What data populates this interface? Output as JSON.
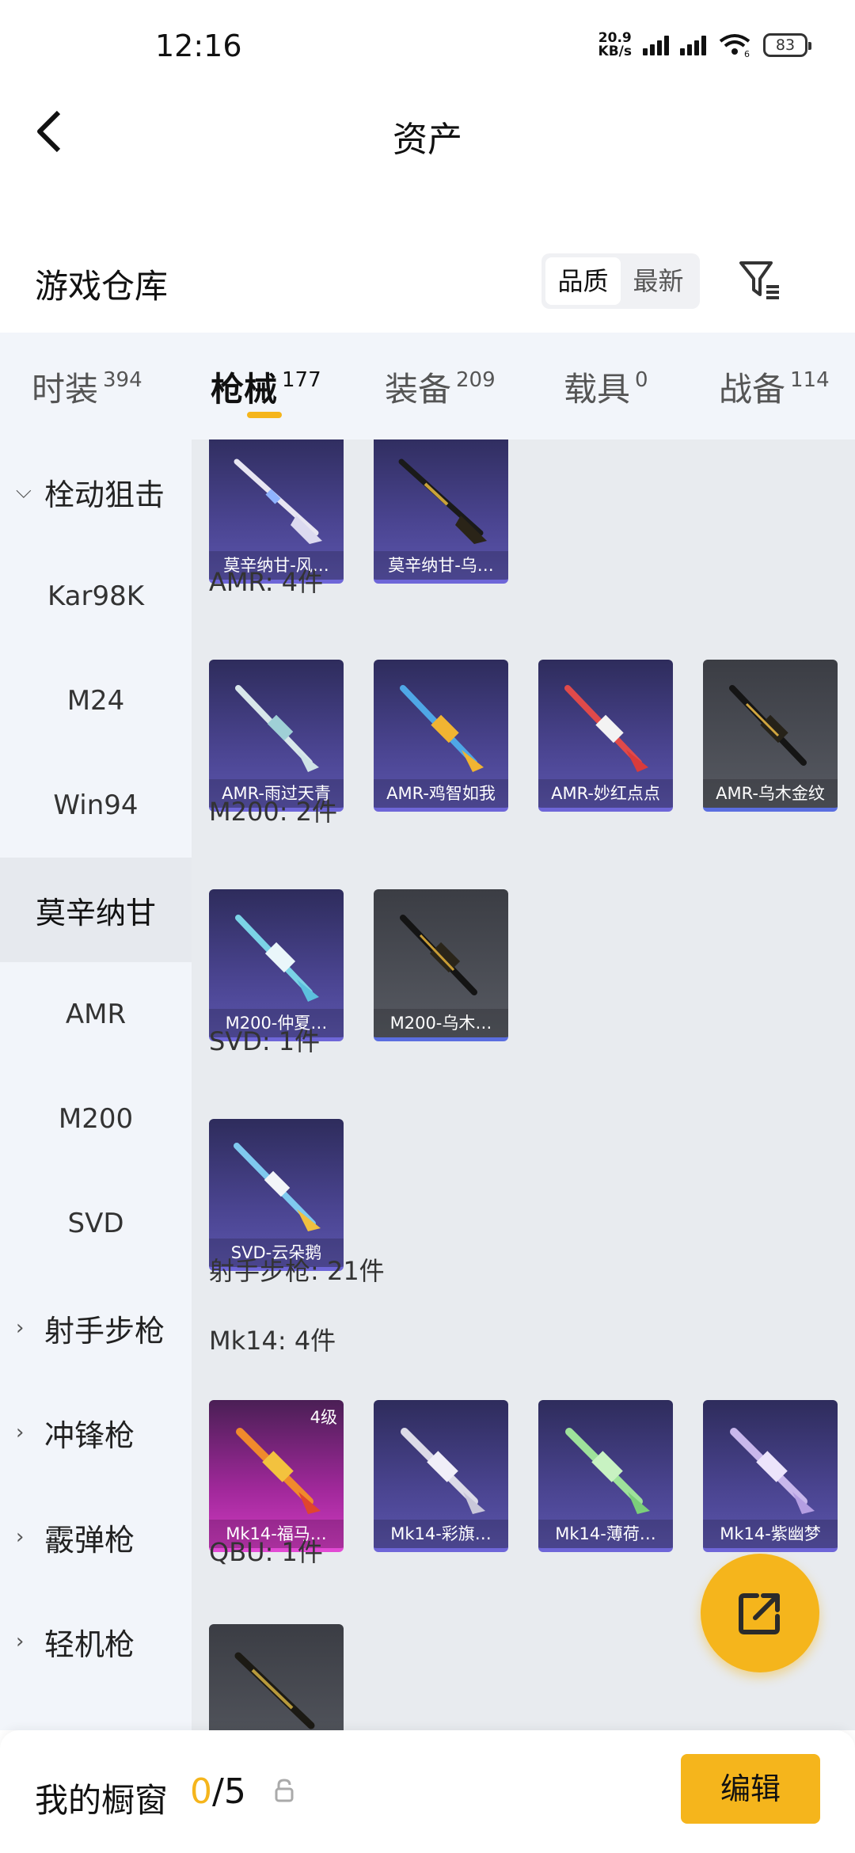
{
  "status_bar": {
    "time": "12:16",
    "net_speed_value": "20.9",
    "net_speed_unit": "KB/s",
    "wifi_badge": "6",
    "battery": "83"
  },
  "header": {
    "title": "资产"
  },
  "warehouse": {
    "title": "游戏仓库",
    "sort_options": [
      "品质",
      "最新"
    ],
    "active_sort": "品质"
  },
  "tabs": [
    {
      "label": "时装",
      "count": "394"
    },
    {
      "label": "枪械",
      "count": "177",
      "active": true
    },
    {
      "label": "装备",
      "count": "209"
    },
    {
      "label": "载具",
      "count": "0"
    },
    {
      "label": "战备",
      "count": "114"
    }
  ],
  "sidebar": [
    {
      "label": "栓动狙击",
      "type": "group",
      "expanded": true
    },
    {
      "label": "Kar98K",
      "type": "sub"
    },
    {
      "label": "M24",
      "type": "sub"
    },
    {
      "label": "Win94",
      "type": "sub"
    },
    {
      "label": "莫辛纳甘",
      "type": "sub",
      "selected": true
    },
    {
      "label": "AMR",
      "type": "sub"
    },
    {
      "label": "M200",
      "type": "sub"
    },
    {
      "label": "SVD",
      "type": "sub"
    },
    {
      "label": "射手步枪",
      "type": "group",
      "expanded": false
    },
    {
      "label": "冲锋枪",
      "type": "group",
      "expanded": false
    },
    {
      "label": "霰弹枪",
      "type": "group",
      "expanded": false
    },
    {
      "label": "轻机枪",
      "type": "group",
      "expanded": false
    }
  ],
  "sections": {
    "amr": "AMR: 4件",
    "m200": "M200: 2件",
    "svd": "SVD: 1件",
    "marksman": "射手步枪: 21件",
    "mk14": "Mk14: 4件",
    "qbu": "QBU: 1件"
  },
  "items": {
    "mosin_1": "莫辛纳甘-风…",
    "mosin_2": "莫辛纳甘-乌…",
    "amr_1": "AMR-雨过天青",
    "amr_2": "AMR-鸡智如我",
    "amr_3": "AMR-妙红点点",
    "amr_4": "AMR-乌木金纹",
    "m200_1": "M200-仲夏…",
    "m200_2": "M200-乌木…",
    "svd_1": "SVD-云朵鹅",
    "mk14_1": "Mk14-福马…",
    "mk14_1_level": "4级",
    "mk14_2": "Mk14-彩旗…",
    "mk14_3": "Mk14-薄荷…",
    "mk14_4": "Mk14-紫幽梦"
  },
  "bottom": {
    "title": "我的橱窗",
    "count_current": "0",
    "count_total": "/5",
    "edit_label": "编辑"
  },
  "colors": {
    "accent": "#f5b51c",
    "sidebar_bg": "#f2f5fa",
    "content_bg": "#e8ebef"
  }
}
